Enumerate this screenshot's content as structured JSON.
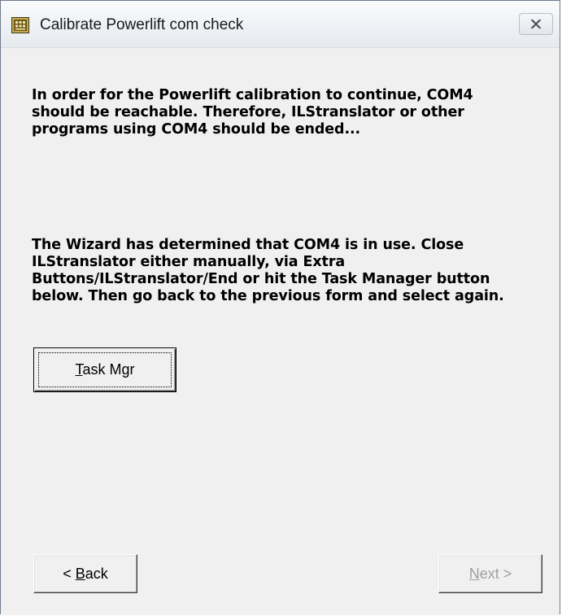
{
  "window": {
    "title": "Calibrate Powerlift com check",
    "close_label": "✕"
  },
  "content": {
    "message_1": "In order for the Powerlift calibration to continue, COM4 should be reachable. Therefore, ILStranslator or other programs using COM4 should be ended...",
    "message_2": "The Wizard has determined that COM4 is in use. Close ILStranslator either manually, via Extra Buttons/ILStranslator/End or hit the Task Manager button below. Then go back to the previous form and select again."
  },
  "buttons": {
    "task_mgr": {
      "mnemonic": "T",
      "rest": "ask Mgr"
    },
    "back": {
      "prefix": "< ",
      "mnemonic": "B",
      "rest": "ack"
    },
    "next": {
      "mnemonic": "N",
      "rest": "ext >",
      "enabled": false
    }
  },
  "colors": {
    "window_bg": "#f0f0f0",
    "disabled_text": "#a0a0a0"
  },
  "icons": {
    "app": "app-icon",
    "close": "close-icon"
  }
}
